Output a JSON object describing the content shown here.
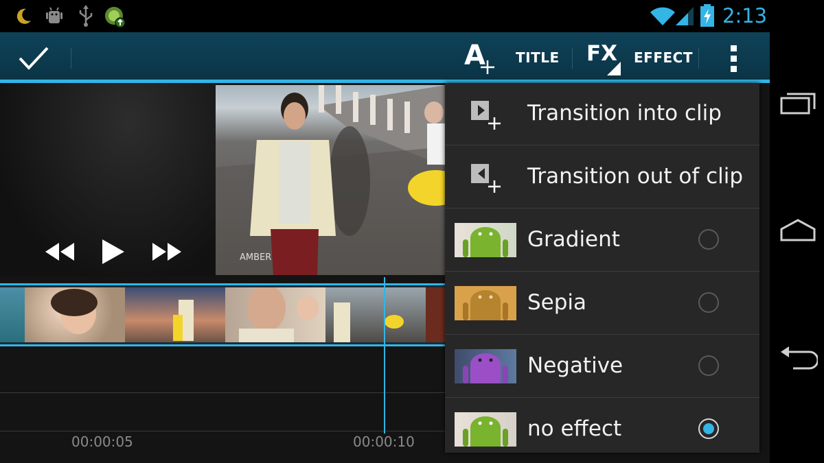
{
  "status_bar": {
    "time": "2:13",
    "icons": [
      "moon-icon",
      "android-debug-icon",
      "usb-icon",
      "app-update-icon",
      "wifi-icon",
      "signal-icon",
      "battery-charging-icon"
    ]
  },
  "action_bar": {
    "done_icon": "checkmark-icon",
    "title_icon": "add-text-icon",
    "title_label": "TITLE",
    "effect_icon_text": "FX",
    "effect_label": "EFFECT",
    "overflow_icon": "overflow-menu-icon"
  },
  "player": {
    "controls": [
      "rewind-icon",
      "play-icon",
      "fast-forward-icon"
    ]
  },
  "timeline": {
    "time_labels": [
      "00:00:05",
      "00:00:10"
    ]
  },
  "effect_menu": {
    "items": [
      {
        "label": "Transition into clip",
        "icon": "transition-in-icon"
      },
      {
        "label": "Transition out of clip",
        "icon": "transition-out-icon"
      },
      {
        "label": "Gradient",
        "icon": "android-gradient-thumb",
        "selected": false
      },
      {
        "label": "Sepia",
        "icon": "android-sepia-thumb",
        "selected": false
      },
      {
        "label": "Negative",
        "icon": "android-negative-thumb",
        "selected": false
      },
      {
        "label": "no effect",
        "icon": "android-normal-thumb",
        "selected": true
      }
    ]
  },
  "nav_bar": {
    "icons": [
      "recent-apps-icon",
      "home-icon",
      "back-icon"
    ]
  },
  "colors": {
    "accent": "#33b5e5",
    "action_bar": "#0f4258",
    "menu_bg": "#272727"
  }
}
